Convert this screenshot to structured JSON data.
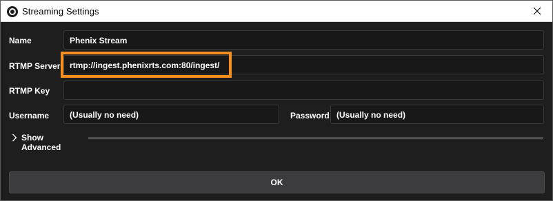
{
  "window": {
    "title": "Streaming Settings",
    "close_icon": "close-icon",
    "app_icon": "obs-logo-icon"
  },
  "form": {
    "name_label": "Name",
    "name_value": "Phenix Stream",
    "server_label": "RTMP Server",
    "server_value": "rtmp://ingest.phenixrts.com:80/ingest/",
    "key_label": "RTMP Key",
    "key_value": "",
    "username_label": "Username",
    "username_value": "(Usually no need)",
    "password_label": "Password",
    "password_value": "(Usually no need)"
  },
  "advanced": {
    "label": "Show Advanced",
    "chevron_icon": "chevron-right-icon"
  },
  "footer": {
    "ok_label": "OK"
  },
  "colors": {
    "highlight": "#f7901e",
    "background": "#1f1e1f",
    "field_bg": "#181819"
  }
}
